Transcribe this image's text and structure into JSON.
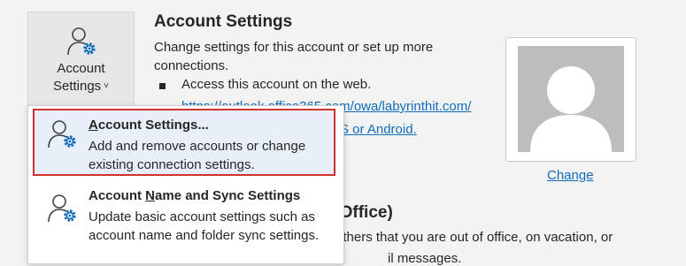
{
  "account_button": {
    "line1": "Account",
    "line2": "Settings",
    "chevron": "˅",
    "icon": "person-gear-icon"
  },
  "section": {
    "title": "Account Settings",
    "description": "Change settings for this account or set up more connections.",
    "bullet_text": "Access this account on the web.",
    "web_link": "https://outlook.office365.com/owa/labyrinthit.com/",
    "mobile_link_partial": "S or Android."
  },
  "profile": {
    "change_label": "Change"
  },
  "out_of_office": {
    "title_partial": "f Office)",
    "text_line1": "others that you are out of office, on vacation, or",
    "text_line2": "il messages."
  },
  "menu": {
    "items": [
      {
        "title_accel": "A",
        "title_rest": "ccount Settings...",
        "description": "Add and remove accounts or change existing connection settings.",
        "icon": "person-gear-icon",
        "highlight_color": "#d0312d"
      },
      {
        "title_pre": "Account ",
        "title_accel": "N",
        "title_rest": "ame and Sync Settings",
        "description": "Update basic account settings such as account name and folder sync settings.",
        "icon": "person-gear-icon"
      }
    ]
  },
  "colors": {
    "link": "#0f6cbd",
    "highlight_border": "#d0312d",
    "gear": "#0f6cbd"
  }
}
